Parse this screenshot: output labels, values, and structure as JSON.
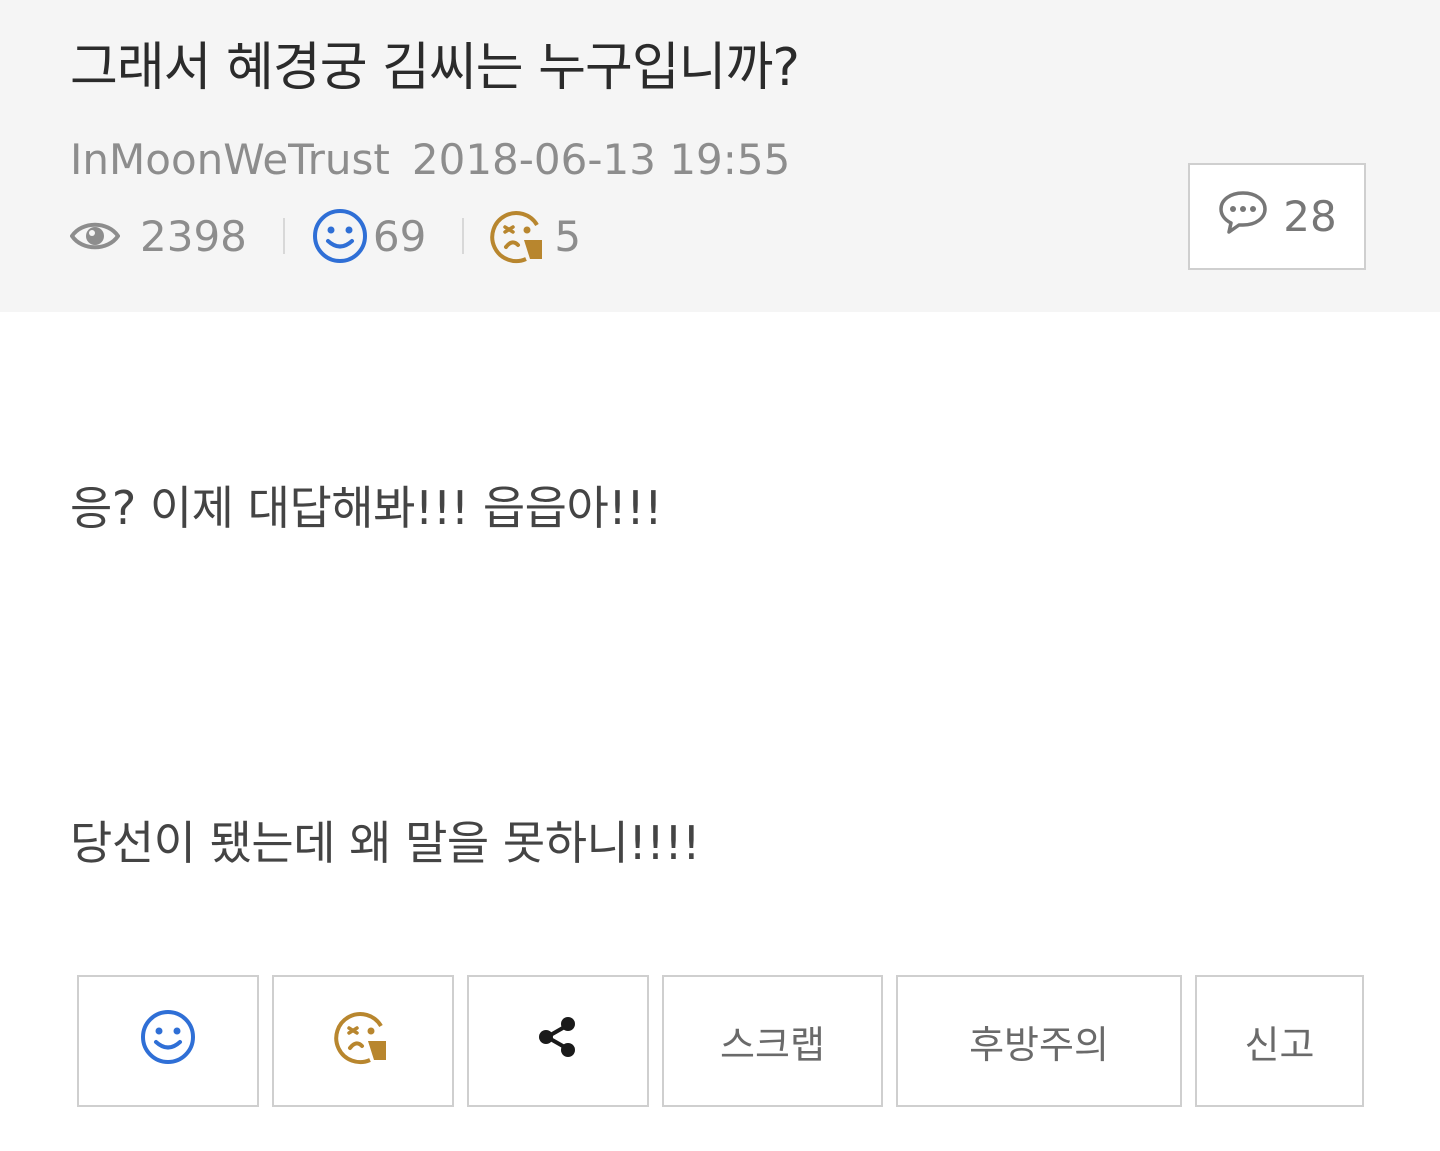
{
  "post": {
    "title": "그래서 혜경궁 김씨는 누구입니까?",
    "author": "InMoonWeTrust",
    "date": "2018-06-13 19:55",
    "views": "2398",
    "likes": "69",
    "dislikes": "5",
    "comments": "28"
  },
  "body": {
    "lines": [
      "응? 이제 대답해봐!!! 읍읍아!!!",
      "당선이 됐는데 왜 말을 못하니!!!!"
    ]
  },
  "actions": {
    "scrap_label": "스크랩",
    "backorder_label": "후방주의",
    "report_label": "신고"
  },
  "icons": {
    "views": "eye-icon",
    "likes": "smile-icon",
    "dislikes": "dislike-face-icon",
    "comments": "speech-bubble-icon",
    "share": "share-icon"
  },
  "colors": {
    "like_blue": "#2f6fd6",
    "dislike_brown": "#b8862e",
    "header_bg": "#f5f5f5"
  }
}
